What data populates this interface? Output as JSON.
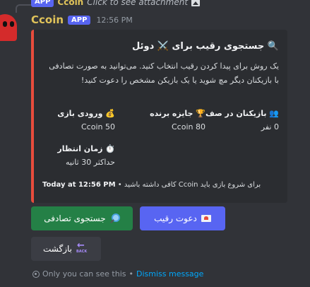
{
  "reference": {
    "app_badge": "APP",
    "author": "Ccoin",
    "hint": "Click to see attachment",
    "icon": "image-icon"
  },
  "message": {
    "author": "Ccoin",
    "app_badge": "APP",
    "timestamp": "12:56 PM",
    "author_color": "#e0c35a"
  },
  "embed": {
    "accent_color": "#e74c3c",
    "title": "🔍 جستجوی رقیب برای ⚔️ دوئل",
    "description": "یک روش برای پیدا کردن رقیب انتخاب کنید. می‌توانید به صورت تصادفی با بازیکنان دیگر مچ شوید یا یک بازیکن مشخص را دعوت کنید!",
    "fields": [
      {
        "name": "👥 بازیکنان در صف",
        "value": "0 نفر"
      },
      {
        "name": "🏆 جایزه برنده",
        "value": "80 Ccoin"
      },
      {
        "name": "💰 ورودی بازی",
        "value": "50 Ccoin"
      },
      {
        "name": "⏱️ زمان انتظار",
        "value": "حداکثر 30 ثانیه"
      }
    ],
    "footer_text": "برای شروع بازی باید Ccoin کافی داشته باشید",
    "footer_sep": "•",
    "footer_time": "Today at 12:56 PM"
  },
  "buttons": {
    "random": {
      "label": "جستجوی تصادفی",
      "icon": "magnifier-icon",
      "color": "#248046"
    },
    "invite": {
      "label": "دعوت رقیب",
      "icon": "envelope-icon",
      "color": "#5865f2"
    },
    "back": {
      "label": "بازگشت",
      "icon": "back-arrow-icon",
      "color": "#3b3d44"
    }
  },
  "ephemeral": {
    "text": "Only you can see this",
    "sep": "•",
    "dismiss": "Dismiss message"
  }
}
